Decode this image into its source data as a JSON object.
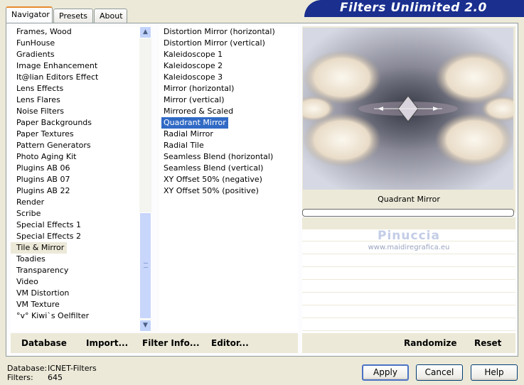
{
  "tabs": [
    "Navigator",
    "Presets",
    "About"
  ],
  "title": "Filters Unlimited 2.0",
  "categories": [
    "Frames, Wood",
    "FunHouse",
    "Gradients",
    "Image Enhancement",
    "It@lian Editors Effect",
    "Lens Effects",
    "Lens Flares",
    "Noise Filters",
    "Paper Backgrounds",
    "Paper Textures",
    "Pattern Generators",
    "Photo Aging Kit",
    "Plugins AB 06",
    "Plugins AB 07",
    "Plugins AB 22",
    "Render",
    "Scribe",
    "Special Effects 1",
    "Special Effects 2",
    "Tile & Mirror",
    "Toadies",
    "Transparency",
    "Video",
    "VM Distortion",
    "VM Texture",
    "°v° Kiwi`s Oelfilter"
  ],
  "selected_category": "Tile & Mirror",
  "filters": [
    "Distortion Mirror (horizontal)",
    "Distortion Mirror (vertical)",
    "Kaleidoscope 1",
    "Kaleidoscope 2",
    "Kaleidoscope 3",
    "Mirror (horizontal)",
    "Mirror (vertical)",
    "Mirrored & Scaled",
    "Quadrant Mirror",
    "Radial Mirror",
    "Radial Tile",
    "Seamless Blend (horizontal)",
    "Seamless Blend (vertical)",
    "XY Offset 50% (negative)",
    "XY Offset 50% (positive)"
  ],
  "selected_filter": "Quadrant Mirror",
  "preview_filter_name": "Quadrant Mirror",
  "watermark": {
    "name": "Pinuccia",
    "site": "www.maidiregrafica.eu"
  },
  "bottom_buttons": {
    "database": "Database",
    "import": "Import...",
    "filter_info": "Filter Info...",
    "editor": "Editor...",
    "randomize": "Randomize",
    "reset": "Reset"
  },
  "footer": {
    "database_label": "Database:",
    "database_value": "ICNET-Filters",
    "filters_label": "Filters:",
    "filters_value": "645"
  },
  "dialog_buttons": {
    "apply": "Apply",
    "cancel": "Cancel",
    "help": "Help"
  },
  "colors": {
    "title_bar": "#1a2f8e",
    "selection": "#316ac5",
    "tab_highlight": "#e68b2c"
  }
}
